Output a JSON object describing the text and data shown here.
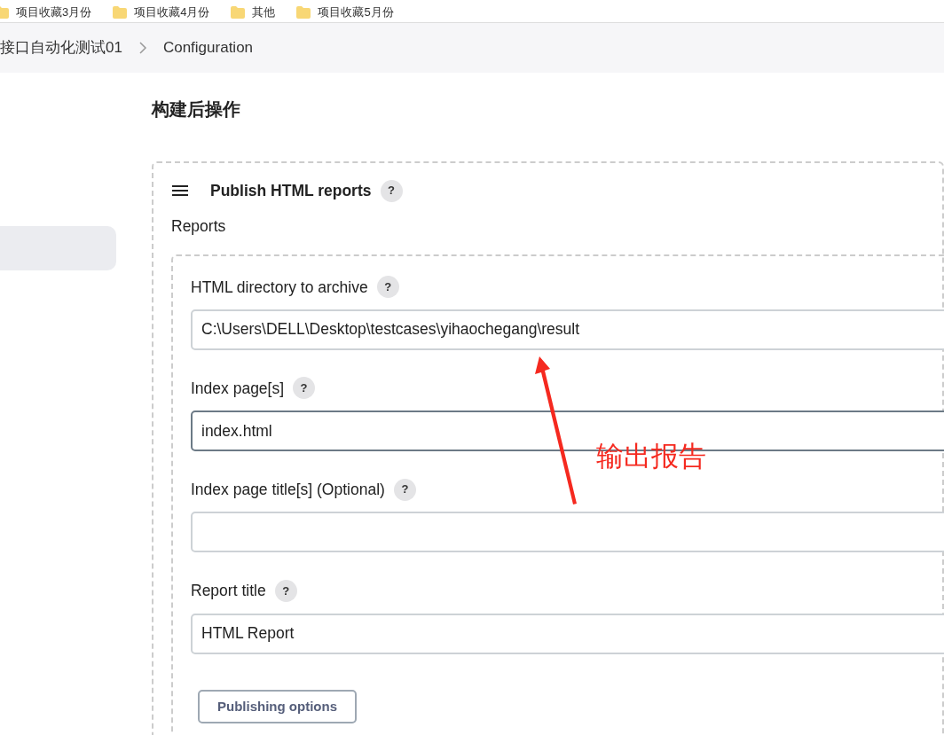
{
  "bookmarks": [
    {
      "label": "项目收藏3月份"
    },
    {
      "label": "项目收藏4月份"
    },
    {
      "label": "其他"
    },
    {
      "label": "项目收藏5月份"
    }
  ],
  "breadcrumb": [
    {
      "label": "接口自动化测试01"
    },
    {
      "label": "Configuration"
    }
  ],
  "sidebar": {
    "items": [
      {
        "selected": true
      }
    ]
  },
  "section_title": "构建后操作",
  "step": {
    "title": "Publish HTML reports",
    "help": "?",
    "reports_label": "Reports",
    "fields": [
      {
        "label": "HTML directory to archive",
        "help": "?",
        "value": "C:\\Users\\DELL\\Desktop\\testcases\\yihaochegang\\result",
        "focused": false
      },
      {
        "label": "Index page[s]",
        "help": "?",
        "value": "index.html",
        "focused": true
      },
      {
        "label": "Index page title[s] (Optional)",
        "help": "?",
        "focused": false
      },
      {
        "label": "Report title",
        "help": "?",
        "value": "HTML Report",
        "focused": false
      }
    ],
    "button": "Publishing options"
  },
  "annotation": {
    "text": "输出报告"
  }
}
